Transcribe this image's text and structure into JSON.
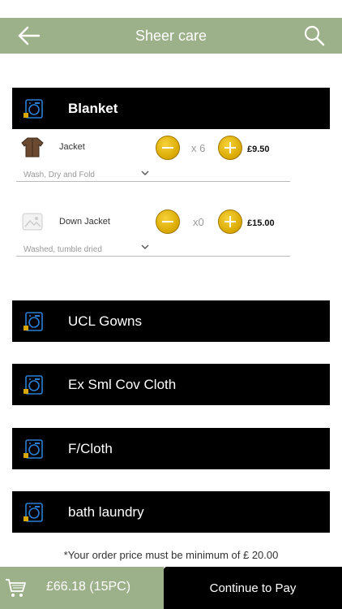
{
  "header": {
    "title": "Sheer care",
    "back_icon": "arrow-left-icon",
    "search_icon": "search-icon"
  },
  "colors": {
    "header_bg": "#9cb08a",
    "category_bg": "#000000",
    "button_yellow": "#e0b000",
    "accent_blue": "#2a7fd4"
  },
  "categories": [
    {
      "label": "Blanket",
      "icon": "washing-machine-icon",
      "expanded": true
    },
    {
      "label": "UCL Gowns",
      "icon": "washing-machine-icon",
      "expanded": false
    },
    {
      "label": "Ex Sml Cov Cloth",
      "icon": "washing-machine-icon",
      "expanded": false
    },
    {
      "label": "F/Cloth",
      "icon": "washing-machine-icon",
      "expanded": false
    },
    {
      "label": "bath laundry",
      "icon": "washing-machine-icon",
      "expanded": false
    }
  ],
  "items": [
    {
      "name": "Jacket",
      "quantity": "x 6",
      "price": "£9.50",
      "service": "Wash, Dry and Fold"
    },
    {
      "name": "Down Jacket",
      "quantity": "x0",
      "price": "£15.00",
      "service": "Washed, tumble dried"
    }
  ],
  "min_order_note": "*Your order price must be minimum of £  20.00",
  "footer": {
    "cart_total": "£66.18 (15PC)",
    "pay_label": "Continue to Pay",
    "cart_icon": "shopping-cart-icon"
  }
}
